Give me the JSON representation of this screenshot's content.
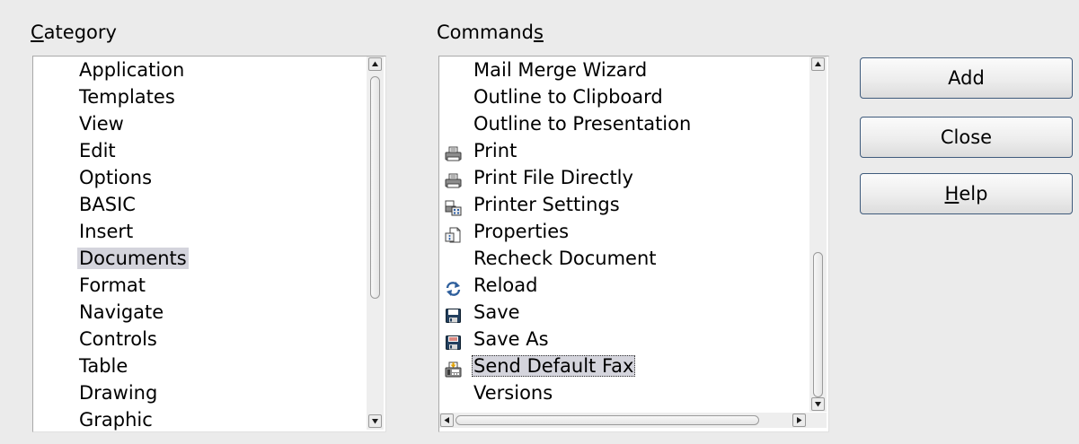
{
  "category": {
    "label_mnemonic": "C",
    "label_rest": "ategory",
    "items": [
      {
        "label": "Application",
        "selected": false
      },
      {
        "label": "Templates",
        "selected": false
      },
      {
        "label": "View",
        "selected": false
      },
      {
        "label": "Edit",
        "selected": false
      },
      {
        "label": "Options",
        "selected": false
      },
      {
        "label": "BASIC",
        "selected": false
      },
      {
        "label": "Insert",
        "selected": false
      },
      {
        "label": "Documents",
        "selected": true
      },
      {
        "label": "Format",
        "selected": false
      },
      {
        "label": "Navigate",
        "selected": false
      },
      {
        "label": "Controls",
        "selected": false
      },
      {
        "label": "Table",
        "selected": false
      },
      {
        "label": "Drawing",
        "selected": false
      },
      {
        "label": "Graphic",
        "selected": false
      }
    ]
  },
  "commands": {
    "label_prefix": "Command",
    "label_mnemonic": "s",
    "items": [
      {
        "label": "Mail Merge Wizard",
        "icon": ""
      },
      {
        "label": "Outline to Clipboard",
        "icon": ""
      },
      {
        "label": "Outline to Presentation",
        "icon": ""
      },
      {
        "label": "Print",
        "icon": "printer-icon"
      },
      {
        "label": "Print File Directly",
        "icon": "printer-icon"
      },
      {
        "label": "Printer Settings",
        "icon": "printer-settings-icon"
      },
      {
        "label": "Properties",
        "icon": "properties-icon"
      },
      {
        "label": "Recheck Document",
        "icon": ""
      },
      {
        "label": "Reload",
        "icon": "reload-icon"
      },
      {
        "label": "Save",
        "icon": "save-icon"
      },
      {
        "label": "Save As",
        "icon": "save-as-icon"
      },
      {
        "label": "Send Default Fax",
        "icon": "fax-icon",
        "focused": true
      },
      {
        "label": "Versions",
        "icon": ""
      }
    ]
  },
  "buttons": {
    "add": {
      "text": "Add"
    },
    "close": {
      "text": "Close"
    },
    "help": {
      "mnemonic": "H",
      "rest": "elp"
    }
  },
  "colors": {
    "dialog_bg": "#ebebeb",
    "list_bg": "#ffffff",
    "selection": "#d4d4dc",
    "button_border": "#3f5b7c"
  }
}
